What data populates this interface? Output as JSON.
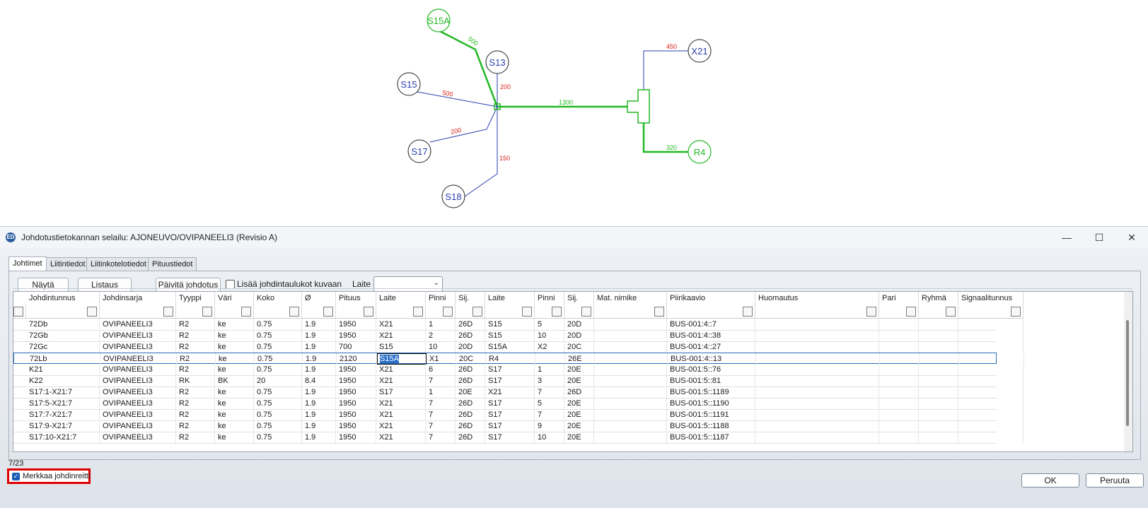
{
  "diagram": {
    "nodes": {
      "S15A": "S15A",
      "S13": "S13",
      "S15": "S15",
      "S17": "S17",
      "S18": "S18",
      "X21": "X21",
      "R4": "R4"
    },
    "labels": {
      "s15a_len": "500",
      "s13_len": "200",
      "s15_len": "500",
      "s17_len": "200",
      "s18_len": "150",
      "trunk_len": "1300",
      "x21_len": "450",
      "r4_len": "320"
    },
    "colors": {
      "highlight": "#22b822",
      "normal": "#2a3fb0",
      "length": "#d8231a",
      "highlight_length": "#22b822"
    }
  },
  "window": {
    "title": "Johdotustietokannan selailu:  AJONEUVO/OVIPANEELI3 (Revisio A)",
    "minimize": "—",
    "maximize": "☐",
    "close": "✕",
    "icon_text": "ED"
  },
  "tabs": [
    "Johtimet",
    "Liitintiedot",
    "Liitinkotelotiedot",
    "Pituustiedot"
  ],
  "toolbar": {
    "nayta": "Näytä",
    "listaus": "Listaus",
    "paivita": "Päivitä johdotus",
    "lisaa": "Lisää johdintaulukot kuvaan",
    "laite_label": "Laite",
    "laite_value": ""
  },
  "columns": [
    "Johdintunnus",
    "Johdinsarja",
    "Tyyppi",
    "Väri",
    "Koko",
    "Ø",
    "Pituus",
    "Laite",
    "Pinni",
    "Sij.",
    "Laite",
    "Pinni",
    "Sij.",
    "Mat. nimike",
    "Piirikaavio",
    "Huomautus",
    "Pari",
    "Ryhmä",
    "Signaalitunnus"
  ],
  "rows": [
    [
      "72Db",
      "OVIPANEELI3",
      "R2",
      "ke",
      "0.75",
      "1.9",
      "1950",
      "X21",
      "1",
      "26D",
      "S15",
      "5",
      "20D",
      "",
      "BUS-001:4::7",
      "",
      "",
      "",
      ""
    ],
    [
      "72Gb",
      "OVIPANEELI3",
      "R2",
      "ke",
      "0.75",
      "1.9",
      "1950",
      "X21",
      "2",
      "26D",
      "S15",
      "10",
      "20D",
      "",
      "BUS-001:4::38",
      "",
      "",
      "",
      ""
    ],
    [
      "72Gc",
      "OVIPANEELI3",
      "R2",
      "ke",
      "0.75",
      "1.9",
      "700",
      "S15",
      "10",
      "20D",
      "S15A",
      "X2",
      "20C",
      "",
      "BUS-001:4::27",
      "",
      "",
      "",
      ""
    ],
    [
      "72Lb",
      "OVIPANEELI3",
      "R2",
      "ke",
      "0.75",
      "1.9",
      "2120",
      "S15A",
      "X1",
      "20C",
      "R4",
      "",
      "26E",
      "",
      "BUS-001:4::13",
      "",
      "",
      "",
      ""
    ],
    [
      "K21",
      "OVIPANEELI3",
      "R2",
      "ke",
      "0.75",
      "1.9",
      "1950",
      "X21",
      "6",
      "26D",
      "S17",
      "1",
      "20E",
      "",
      "BUS-001:5::76",
      "",
      "",
      "",
      ""
    ],
    [
      "K22",
      "OVIPANEELI3",
      "RK",
      "BK",
      "20",
      "8.4",
      "1950",
      "X21",
      "7",
      "26D",
      "S17",
      "3",
      "20E",
      "",
      "BUS-001:5::81",
      "",
      "",
      "",
      ""
    ],
    [
      "S17:1-X21:7",
      "OVIPANEELI3",
      "R2",
      "ke",
      "0.75",
      "1.9",
      "1950",
      "S17",
      "1",
      "20E",
      "X21",
      "7",
      "26D",
      "",
      "BUS-001:5::1189",
      "",
      "",
      "",
      ""
    ],
    [
      "S17:5-X21:7",
      "OVIPANEELI3",
      "R2",
      "ke",
      "0.75",
      "1.9",
      "1950",
      "X21",
      "7",
      "26D",
      "S17",
      "5",
      "20E",
      "",
      "BUS-001:5::1190",
      "",
      "",
      "",
      ""
    ],
    [
      "S17:7-X21:7",
      "OVIPANEELI3",
      "R2",
      "ke",
      "0.75",
      "1.9",
      "1950",
      "X21",
      "7",
      "26D",
      "S17",
      "7",
      "20E",
      "",
      "BUS-001:5::1191",
      "",
      "",
      "",
      ""
    ],
    [
      "S17:9-X21:7",
      "OVIPANEELI3",
      "R2",
      "ke",
      "0.75",
      "1.9",
      "1950",
      "X21",
      "7",
      "26D",
      "S17",
      "9",
      "20E",
      "",
      "BUS-001:5::1188",
      "",
      "",
      "",
      ""
    ],
    [
      "S17:10-X21:7",
      "OVIPANEELI3",
      "R2",
      "ke",
      "0.75",
      "1.9",
      "1950",
      "X21",
      "7",
      "26D",
      "S17",
      "10",
      "20E",
      "",
      "BUS-001:5::1187",
      "",
      "",
      "",
      ""
    ]
  ],
  "selected_row": 3,
  "status": "7/23",
  "footer": {
    "merkkaa": "Merkkaa johdinreitti",
    "ok": "OK",
    "peruuta": "Peruuta"
  }
}
